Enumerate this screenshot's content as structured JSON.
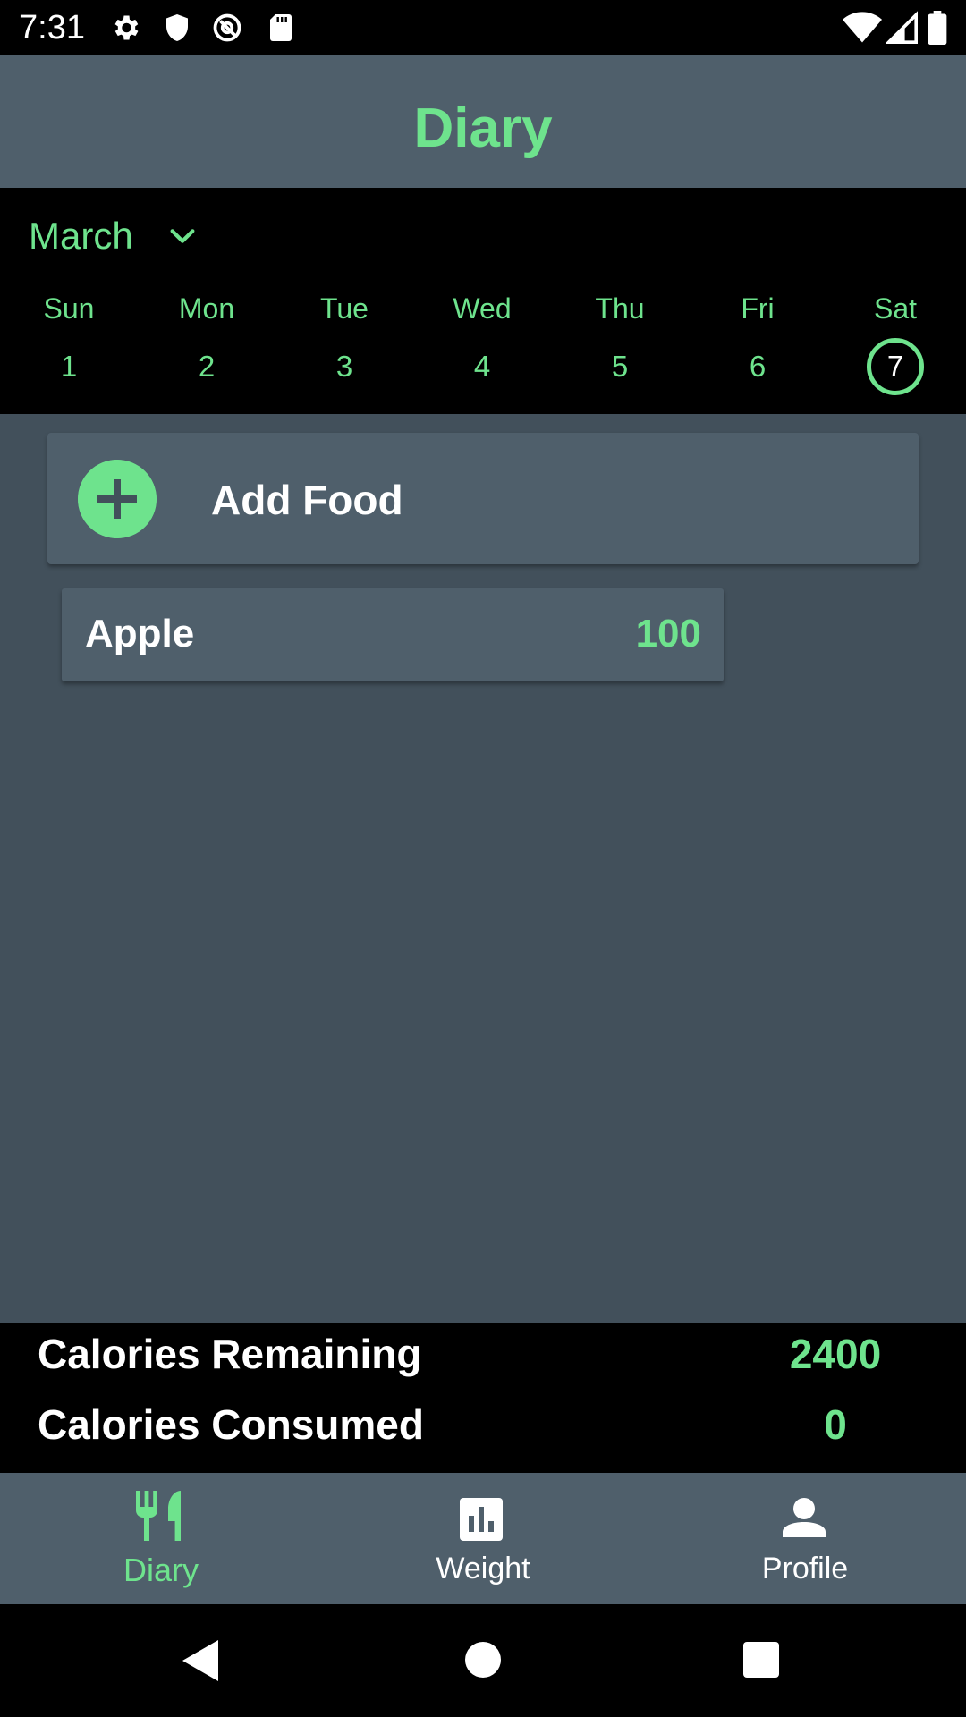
{
  "status_bar": {
    "time": "7:31",
    "icons": [
      "gear-icon",
      "shield-icon",
      "at-sign-icon",
      "sd-card-icon",
      "wifi-icon",
      "signal-icon",
      "battery-icon"
    ]
  },
  "header": {
    "title": "Diary"
  },
  "calendar": {
    "month": "March",
    "days": [
      {
        "name": "Sun",
        "num": "1"
      },
      {
        "name": "Mon",
        "num": "2"
      },
      {
        "name": "Tue",
        "num": "3"
      },
      {
        "name": "Wed",
        "num": "4"
      },
      {
        "name": "Thu",
        "num": "5"
      },
      {
        "name": "Fri",
        "num": "6"
      },
      {
        "name": "Sat",
        "num": "7"
      }
    ],
    "selected_day": "7"
  },
  "add_food": {
    "label": "Add Food"
  },
  "food_entries": [
    {
      "name": "Apple",
      "calories": "100"
    }
  ],
  "summary": {
    "remaining_label": "Calories Remaining",
    "remaining_value": "2400",
    "consumed_label": "Calories Consumed",
    "consumed_value": "0"
  },
  "bottom_nav": {
    "items": [
      {
        "label": "Diary",
        "icon": "fork-knife-icon",
        "active": true
      },
      {
        "label": "Weight",
        "icon": "bar-chart-icon",
        "active": false
      },
      {
        "label": "Profile",
        "icon": "person-icon",
        "active": false
      }
    ]
  },
  "colors": {
    "accent": "#6ee38d",
    "surface": "#4f5f6b",
    "background": "#42505b",
    "black": "#000000"
  }
}
